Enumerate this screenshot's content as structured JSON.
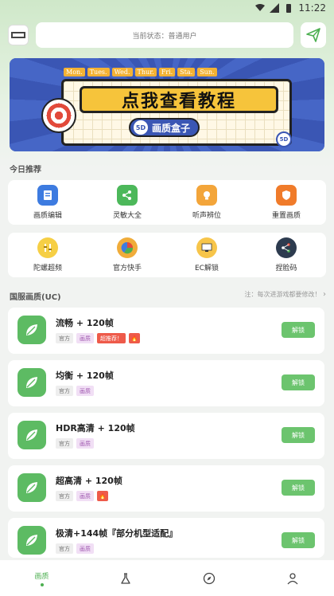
{
  "status_bar": {
    "time": "11:22"
  },
  "header": {
    "logo_icon": "app-logo-icon",
    "status_text": "当前状态：普通用户",
    "send_icon": "paper-plane-icon"
  },
  "banner": {
    "days": [
      "Mon.",
      "Tues.",
      "Wed.",
      "Thur.",
      "Fri.",
      "Sta.",
      "Sun."
    ],
    "title": "点我查看教程",
    "subtitle": "画质盒子",
    "badge": "5D"
  },
  "today": {
    "title": "今日推荐",
    "row1": [
      {
        "label": "画质编辑",
        "icon": "document-edit-icon",
        "color": "#3d7be0"
      },
      {
        "label": "灵敏大全",
        "icon": "share-icon",
        "color": "#4cb85a"
      },
      {
        "label": "听声辨位",
        "icon": "lightbulb-icon",
        "color": "#f3a53a"
      },
      {
        "label": "重置画质",
        "icon": "shield-icon",
        "color": "#f07b2a"
      }
    ],
    "row2": [
      {
        "label": "陀螺超频",
        "icon": "gyro-icon",
        "color": "#f6cf45"
      },
      {
        "label": "官方快手",
        "icon": "pie-chart-icon",
        "color": "#f0ac3a"
      },
      {
        "label": "EC解锁",
        "icon": "monitor-icon",
        "color": "#f7c54a"
      },
      {
        "label": "捏脸码",
        "icon": "share-nodes-icon",
        "color": "#2d3b4f"
      }
    ]
  },
  "national": {
    "title": "国服画质(UC)",
    "note": "注：每次进游戏都要修改！"
  },
  "items": [
    {
      "title": "流畅 + 120帧",
      "tags": [
        "官方",
        "画质",
        "超推荐！",
        "🔥"
      ],
      "button": "解锁"
    },
    {
      "title": "均衡 + 120帧",
      "tags": [
        "官方",
        "画质"
      ],
      "button": "解锁"
    },
    {
      "title": "HDR高清 + 120帧",
      "tags": [
        "官方",
        "画质"
      ],
      "button": "解锁"
    },
    {
      "title": "超高清 + 120帧",
      "tags": [
        "官方",
        "画质",
        "🔥"
      ],
      "button": "解锁"
    },
    {
      "title": "极清+144帧『部分机型适配』",
      "tags": [
        "官方",
        "画质"
      ],
      "button": "解锁"
    }
  ],
  "bottom_nav": [
    {
      "label": "画质",
      "icon": "home-icon",
      "active": true
    },
    {
      "label": "",
      "icon": "flask-icon"
    },
    {
      "label": "",
      "icon": "compass-icon"
    },
    {
      "label": "",
      "icon": "user-icon"
    }
  ]
}
